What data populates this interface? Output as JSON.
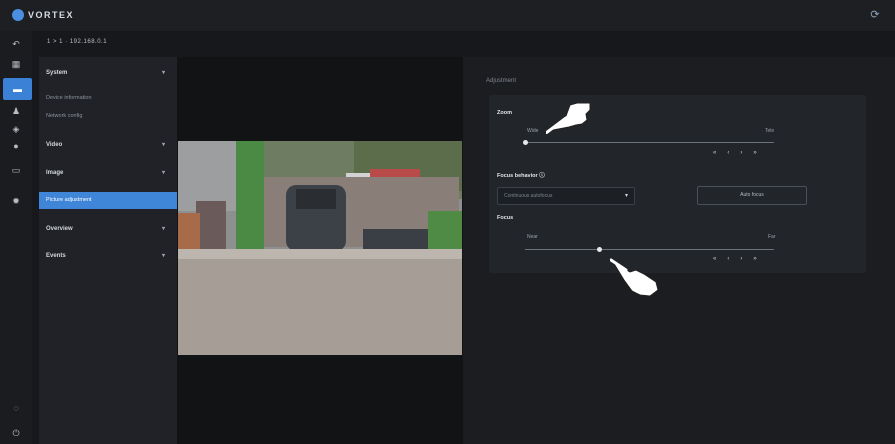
{
  "app": {
    "logo_text": "VORTEX"
  },
  "breadcrumb": "1 > 1 · 192.168.0.1",
  "nav": {
    "groups": [
      {
        "label": "System",
        "chevron": "▾"
      },
      {
        "label": "Video",
        "chevron": "▾"
      },
      {
        "label": "Image",
        "chevron": "▾"
      },
      {
        "label": "Overview",
        "chevron": "▾"
      },
      {
        "label": "Events",
        "chevron": "▾"
      }
    ],
    "sub_items": [
      "Device information",
      "Network config"
    ],
    "active_item": "Picture adjustment"
  },
  "settings": {
    "section_title": "Adjustment",
    "rows": [
      {
        "label": "Zoom",
        "min_label": "Wide",
        "max_label": "Tele",
        "value": 0.0
      },
      {
        "label": "Focus",
        "min_label": "Near",
        "max_label": "Far",
        "value": 0.3
      }
    ],
    "step_buttons": [
      "«",
      "‹",
      "›",
      "»"
    ],
    "focus_mode": {
      "label": "Focus behavior",
      "info_icon": "ⓘ",
      "select_value": "Continuous autofocus",
      "button_label": "Auto focus"
    }
  },
  "icons": {
    "rail": [
      "grid-icon",
      "camera-icon",
      "user-icon",
      "event-icon",
      "alarm-icon",
      "storage-icon",
      "settings-icon"
    ],
    "bottom": [
      "help-icon",
      "power-icon"
    ],
    "top_right": "sync-icon"
  }
}
